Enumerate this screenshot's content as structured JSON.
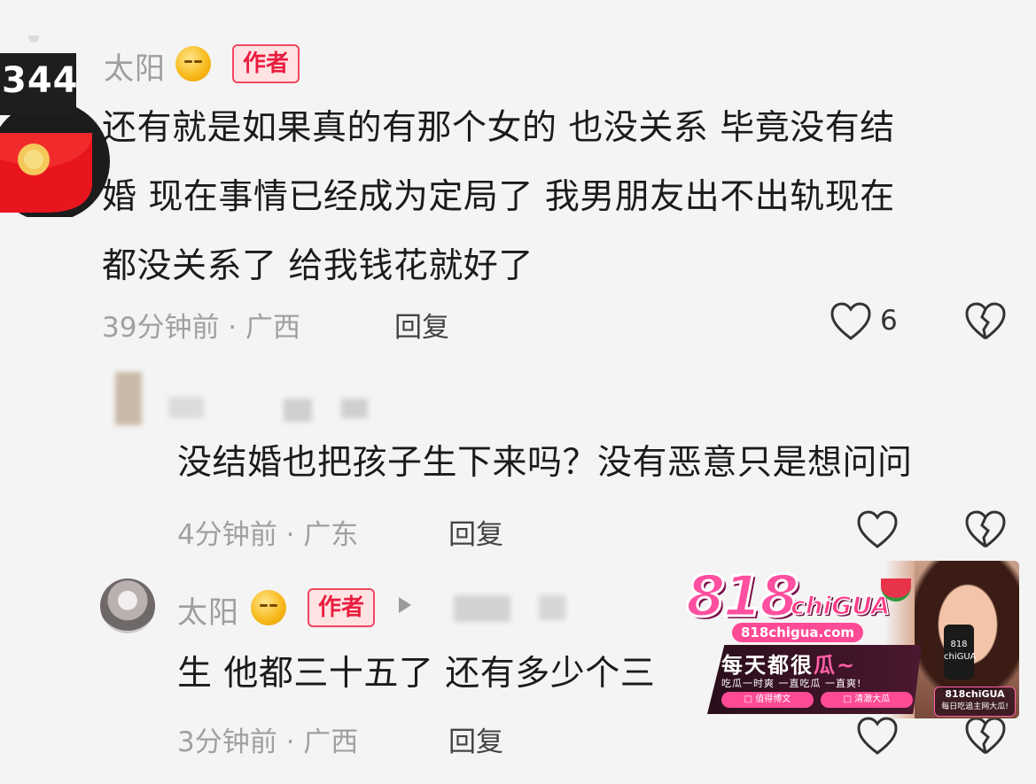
{
  "comments": [
    {
      "username": "太阳",
      "badge": "作者",
      "avatar_badge_text": "344",
      "lines": [
        "还有就是如果真的有那个女的 也没关系 毕竟没有结",
        "婚 现在事情已经成为定局了 我男朋友出不出轨现在",
        "都没关系了 给我钱花就好了"
      ],
      "time_location": "39分钟前 · 广西",
      "reply_label": "回复",
      "like_count": "6"
    },
    {
      "text": "没结婚也把孩子生下来吗？没有恶意只是想问问",
      "time_location": "4分钟前 · 广东",
      "reply_label": "回复"
    },
    {
      "username": "太阳",
      "badge": "作者",
      "text": "生 他都三十五了 还有多少个三",
      "time_location": "3分钟前 · 广西",
      "reply_label": "回复"
    }
  ],
  "ad": {
    "logo": "818",
    "logo_suffix": "chiGUA",
    "url": "818chigua.com",
    "slogan_main": "每天都很",
    "slogan_accent": "瓜~",
    "subtitle": "吃瓜一时爽 一直吃瓜 一直爽!",
    "chip_left": "□ 值得博文",
    "chip_right": "□ 清澈大瓜",
    "phone_text": "818\nchiGUA",
    "badge_title": "818chiGUA",
    "badge_sub": "每日吃追主网大瓜!"
  },
  "icons": {
    "like": "heart-outline-icon",
    "dislike": "broken-heart-icon"
  },
  "colors": {
    "badge_red": "#ea1d3f",
    "ad_pink": "#ff4fa0"
  }
}
